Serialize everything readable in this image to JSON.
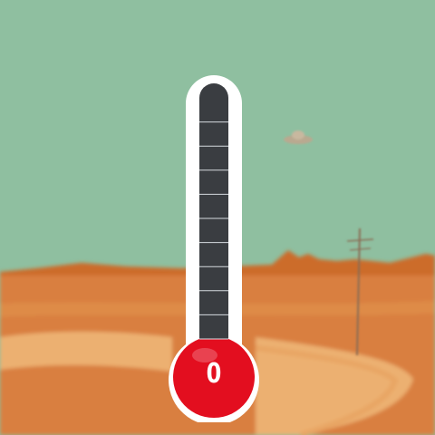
{
  "thermometer": {
    "reading": "0",
    "fill_fraction": 0,
    "segments": 10
  },
  "colors": {
    "sky": "#8fbfa0",
    "mountains": "#cc6c2c",
    "desert": "#d97f3f",
    "road": "#ecb071",
    "tube_frame": "#ffffff",
    "tube_empty": "#3a3d41",
    "tube_line": "#d6dbe0",
    "bulb": "#e30e1f",
    "utility_pole": "#8a6d55",
    "ufo": "#b9a990"
  }
}
